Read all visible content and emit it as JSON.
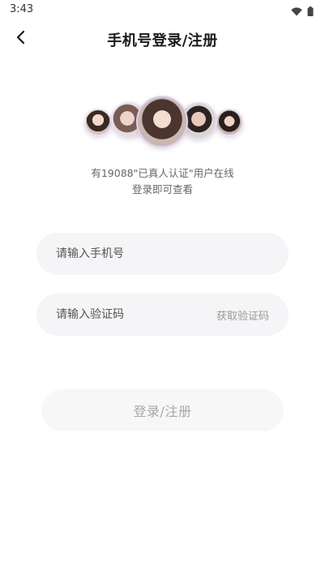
{
  "status_bar": {
    "time": "3:43",
    "icons": [
      "wifi-icon",
      "battery-icon"
    ]
  },
  "header": {
    "back_icon": "chevron-left-icon",
    "title": "手机号登录/注册"
  },
  "avatars": [
    "avatar-1",
    "avatar-2",
    "avatar-3",
    "avatar-4",
    "avatar-5"
  ],
  "info": {
    "line1": "有19088\"已真人认证\"用户在线",
    "line2": "登录即可查看"
  },
  "phone_input": {
    "value": "",
    "placeholder": "请输入手机号"
  },
  "code_input": {
    "value": "",
    "placeholder": "请输入验证码",
    "get_code_label": "获取验证码"
  },
  "submit": {
    "label": "登录/注册"
  },
  "colors": {
    "input_bg": "#f5f5f7",
    "button_bg": "#f7f7f7",
    "button_text": "#a8a8a8",
    "title_text": "#1a1a1a",
    "hint_text": "#666666"
  }
}
